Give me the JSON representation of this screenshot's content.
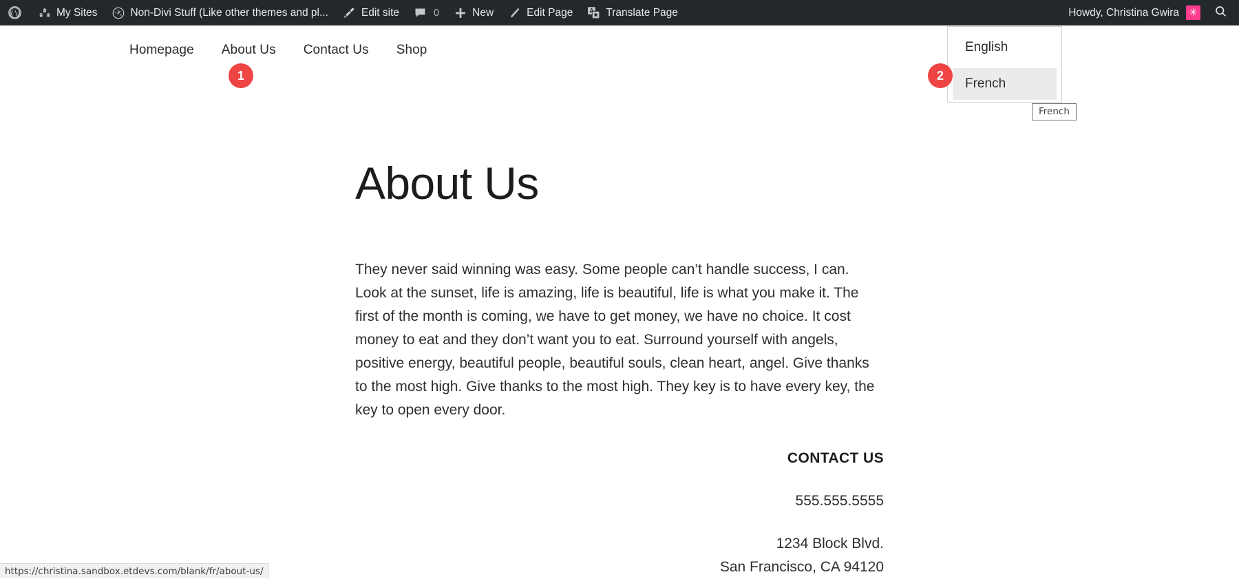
{
  "admin_bar": {
    "wp_logo": "wordpress-logo",
    "items": [
      {
        "icon": "my-sites-icon",
        "label": "My Sites"
      },
      {
        "icon": "dashboard-icon",
        "label": "Non-Divi Stuff (Like other themes and pl..."
      },
      {
        "icon": "edit-site-icon",
        "label": "Edit site"
      },
      {
        "icon": "comments-icon",
        "label": "",
        "count": "0"
      },
      {
        "icon": "plus-icon",
        "label": "New"
      },
      {
        "icon": "pencil-icon",
        "label": "Edit Page"
      },
      {
        "icon": "translate-icon",
        "label": "Translate Page"
      }
    ],
    "howdy": "Howdy, Christina Gwira",
    "avatar_glyph": "✳",
    "avatar_color": "#ff3c8c",
    "search_icon": "search-icon"
  },
  "site_nav": {
    "links": [
      {
        "label": "Homepage"
      },
      {
        "label": "About Us"
      },
      {
        "label": "Contact Us"
      },
      {
        "label": "Shop"
      }
    ]
  },
  "language_dropdown": {
    "options": [
      {
        "label": "English",
        "highlighted": false
      },
      {
        "label": "French",
        "highlighted": true
      }
    ],
    "tooltip": "French"
  },
  "badges": {
    "one": "1",
    "two": "2",
    "color": "#ef4444"
  },
  "page": {
    "title": "About Us",
    "body": "They never said winning was easy. Some people can’t handle success, I can. Look at the sunset, life is amazing, life is beautiful, life is what you make it. The first of the month is coming, we have to get money, we have no choice. It cost money to eat and they don’t want you to eat. Surround yourself with angels, positive energy, beautiful people, beautiful souls, clean heart, angel. Give thanks to the most high. Give thanks to the most high. They key is to have every key, the key to open every door.",
    "contact_heading": "CONTACT US",
    "phone": "555.555.5555",
    "address_line_1": "1234 Block Blvd.",
    "address_line_2": "San Francisco, CA 94120"
  },
  "status_bar": {
    "url": "https://christina.sandbox.etdevs.com/blank/fr/about-us/"
  }
}
